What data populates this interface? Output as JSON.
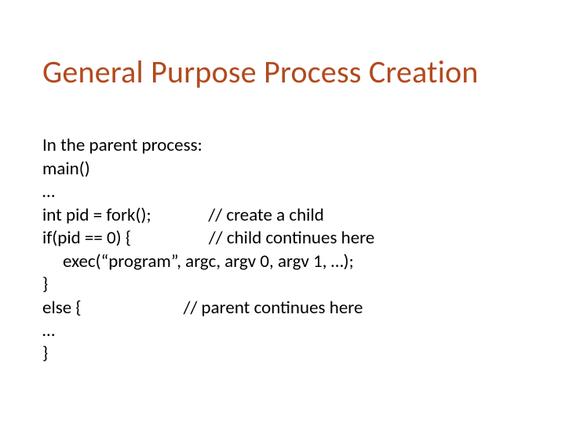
{
  "title": "General Purpose Process Creation",
  "lines": {
    "l0": "In the parent process:",
    "l1": "main()",
    "l2": "…",
    "l3": "int pid = fork();              // create a child",
    "l4": "if(pid == 0) {                   // child continues here",
    "l5": "     exec(“program”, argc, argv 0, argv 1, …);",
    "l6": "}",
    "l7": "else {                         // parent continues here",
    "l8": "…",
    "l9": "}"
  }
}
